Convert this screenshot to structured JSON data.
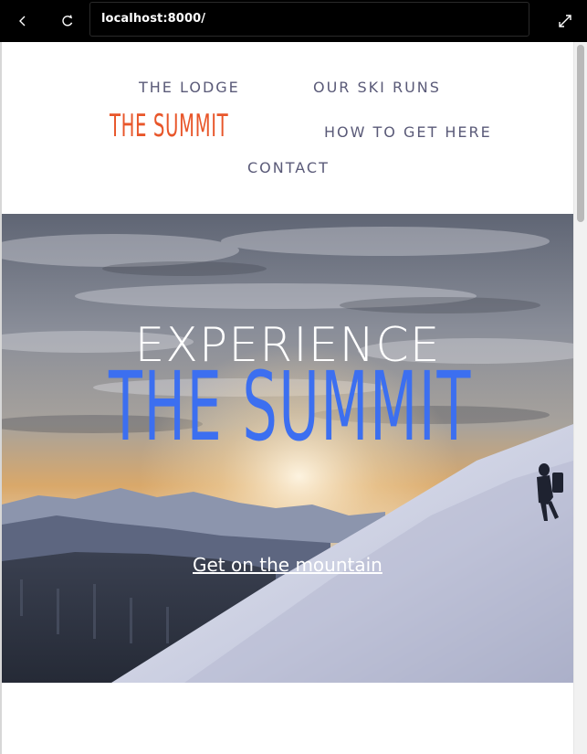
{
  "browser": {
    "url": "localhost:8000/"
  },
  "nav": {
    "items": [
      {
        "label": "THE LODGE"
      },
      {
        "label": "OUR SKI RUNS"
      },
      {
        "label": "HOW TO GET HERE"
      },
      {
        "label": "CONTACT"
      }
    ],
    "logo": "THE SUMMIT"
  },
  "hero": {
    "line1": "EXPERIENCE",
    "line2": "THE SUMMIT",
    "cta": "Get on the mountain"
  },
  "colors": {
    "logo": "#e8562a",
    "hero_title": "#3c6ff0",
    "nav_text": "#5a5a78"
  }
}
